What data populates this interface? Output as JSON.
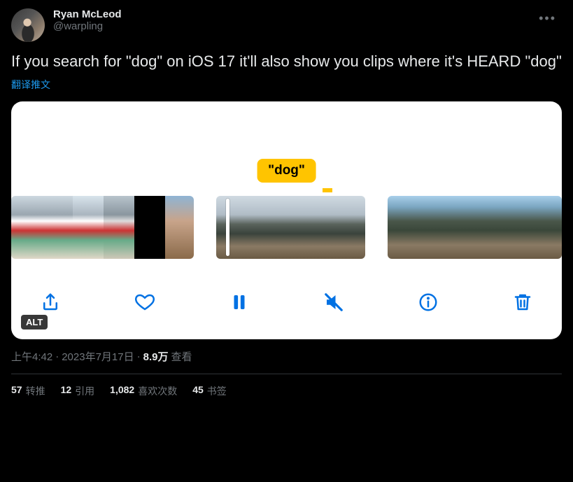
{
  "header": {
    "display_name": "Ryan McLeod",
    "handle": "@warpling"
  },
  "tweet": {
    "text": "If you search for \"dog\" on iOS 17 it'll also show you clips where it's HEARD \"dog\"",
    "translate_label": "翻译推文"
  },
  "media": {
    "tooltip": "\"dog\"",
    "alt_badge": "ALT"
  },
  "meta": {
    "time": "上午4:42",
    "sep1": " · ",
    "date": "2023年7月17日",
    "sep2": " · ",
    "views_count": "8.9万",
    "views_label": " 查看"
  },
  "stats": {
    "retweets_count": "57",
    "retweets_label": "转推",
    "quotes_count": "12",
    "quotes_label": "引用",
    "likes_count": "1,082",
    "likes_label": "喜欢次数",
    "bookmarks_count": "45",
    "bookmarks_label": "书签"
  }
}
